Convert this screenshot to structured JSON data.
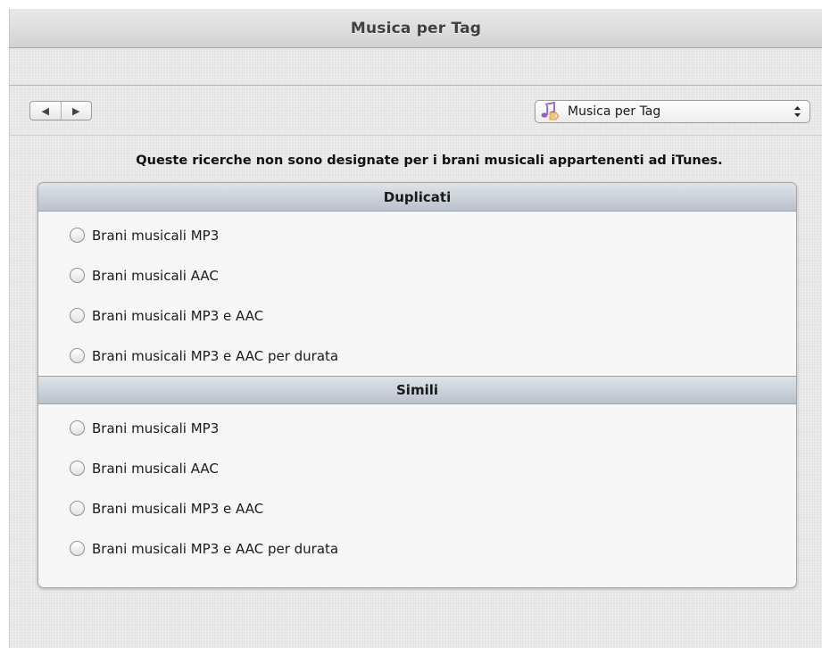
{
  "window": {
    "title": "Musica per Tag"
  },
  "navigation": {
    "back_icon": "back-arrow-icon",
    "forward_icon": "forward-arrow-icon",
    "back_glyph": "◀",
    "forward_glyph": "▶"
  },
  "popup": {
    "icon": "music-tag-icon",
    "selected": "Musica per Tag",
    "arrows_glyph": "⬍"
  },
  "notice": "Queste ricerche non sono designate per i brani musicali appartenenti ad iTunes.",
  "sections": [
    {
      "header": "Duplicati",
      "options": [
        {
          "label": "Brani musicali MP3",
          "selected": false
        },
        {
          "label": "Brani musicali AAC",
          "selected": false
        },
        {
          "label": "Brani musicali MP3 e AAC",
          "selected": false
        },
        {
          "label": "Brani musicali MP3 e AAC per durata",
          "selected": false
        }
      ]
    },
    {
      "header": "Simili",
      "options": [
        {
          "label": "Brani musicali MP3",
          "selected": false
        },
        {
          "label": "Brani musicali AAC",
          "selected": false
        },
        {
          "label": "Brani musicali MP3 e AAC",
          "selected": false
        },
        {
          "label": "Brani musicali MP3 e AAC per durata",
          "selected": false
        }
      ]
    }
  ],
  "colors": {
    "section_header_top": "#dfe4ea",
    "section_header_bottom": "#b9c1cb",
    "window_background": "#ececec"
  }
}
